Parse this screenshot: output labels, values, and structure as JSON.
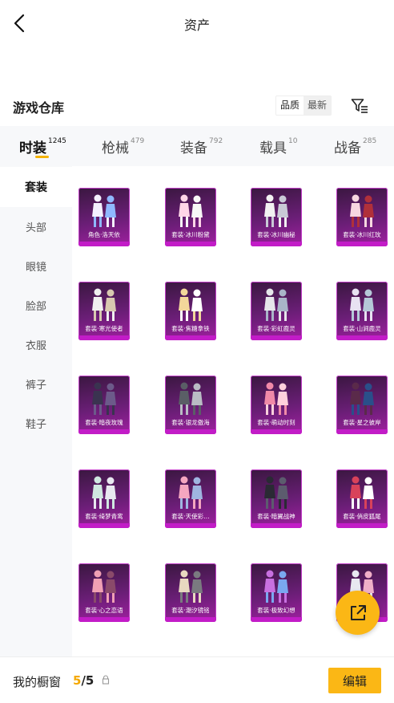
{
  "header": {
    "title": "资产",
    "back_icon": "chevron-left-icon"
  },
  "section": {
    "title": "游戏仓库",
    "sort_options": [
      "品质",
      "最新"
    ],
    "filter_icon": "filter-list-icon"
  },
  "tabs": [
    {
      "label": "时装",
      "count": "1245",
      "active": true
    },
    {
      "label": "枪械",
      "count": "479",
      "active": false
    },
    {
      "label": "装备",
      "count": "792",
      "active": false
    },
    {
      "label": "载具",
      "count": "10",
      "active": false
    },
    {
      "label": "战备",
      "count": "285",
      "active": false
    }
  ],
  "sidebar": {
    "items": [
      {
        "label": "套装",
        "active": true
      },
      {
        "label": "头部",
        "active": false
      },
      {
        "label": "眼镜",
        "active": false
      },
      {
        "label": "脸部",
        "active": false
      },
      {
        "label": "衣服",
        "active": false
      },
      {
        "label": "裤子",
        "active": false
      },
      {
        "label": "鞋子",
        "active": false
      }
    ]
  },
  "items": [
    "角色·洛天依",
    "套装·冰川粉黛",
    "套装·冰川幽秘",
    "套装·冰川红玫",
    "套装·寒光使者",
    "套装·焦糖拿铁",
    "套装·彩虹鹿灵",
    "套装·山涧鹿灵",
    "套装·暗夜玫瑰",
    "套装·银龙傲海",
    "套装·萌动时刻",
    "套装·星之彼岸",
    "套装·绮梦青鸾",
    "套装·天使彩…",
    "套装·暗翼战神",
    "套装·俏皮狐尾",
    "套装·心之恋语",
    "套装·潮汐镜铭",
    "套装·极致幻想",
    "套装·…回"
  ],
  "colors": {
    "accent": "#fbb715",
    "card_frame": "#c21cc7",
    "card_bg": "#6a1e76"
  },
  "showcase": {
    "label": "我的橱窗",
    "current": "5",
    "total": "/5",
    "lock_icon": "lock-icon"
  },
  "edit_button": {
    "label": "编辑"
  },
  "fab": {
    "icon": "external-share-icon"
  }
}
